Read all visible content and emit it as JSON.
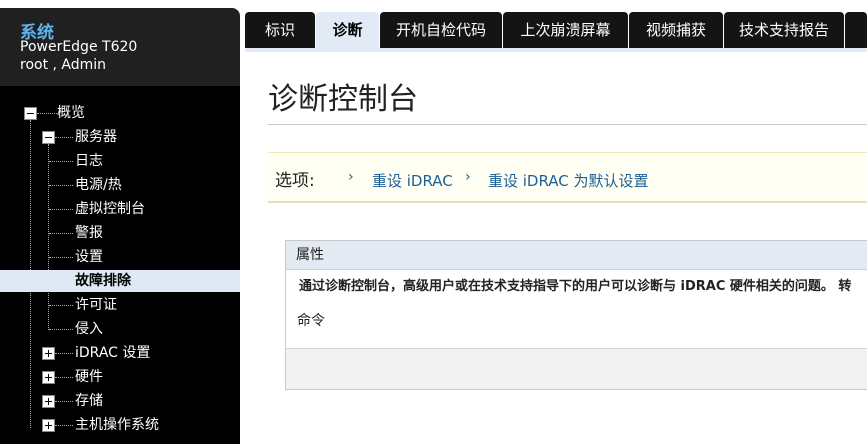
{
  "system": {
    "title": "系统",
    "model": "PowerEdge T620",
    "user": "root , Admin"
  },
  "tree": {
    "overview": "概览",
    "server": "服务器",
    "logs": "日志",
    "power_thermal": "电源/热",
    "virtual_console": "虚拟控制台",
    "alerts": "警报",
    "settings": "设置",
    "troubleshooting": "故障排除",
    "licenses": "许可证",
    "intrusion": "侵入",
    "idrac_settings": "iDRAC 设置",
    "hardware": "硬件",
    "storage": "存储",
    "host_os": "主机操作系统"
  },
  "tabs": [
    {
      "label": "标识"
    },
    {
      "label": "诊断"
    },
    {
      "label": "开机自检代码"
    },
    {
      "label": "上次崩溃屏幕"
    },
    {
      "label": "视频捕获"
    },
    {
      "label": "技术支持报告"
    }
  ],
  "main": {
    "title": "诊断控制台",
    "options_label": "选项:",
    "link_reset": "重设 iDRAC",
    "link_reset_defaults": "重设 iDRAC 为默认设置"
  },
  "panel": {
    "header": "属性",
    "description": "通过诊断控制台，高级用户或在技术支持指导下的用户可以诊断与 iDRAC 硬件相关的问题。 转",
    "command_label": "命令"
  }
}
